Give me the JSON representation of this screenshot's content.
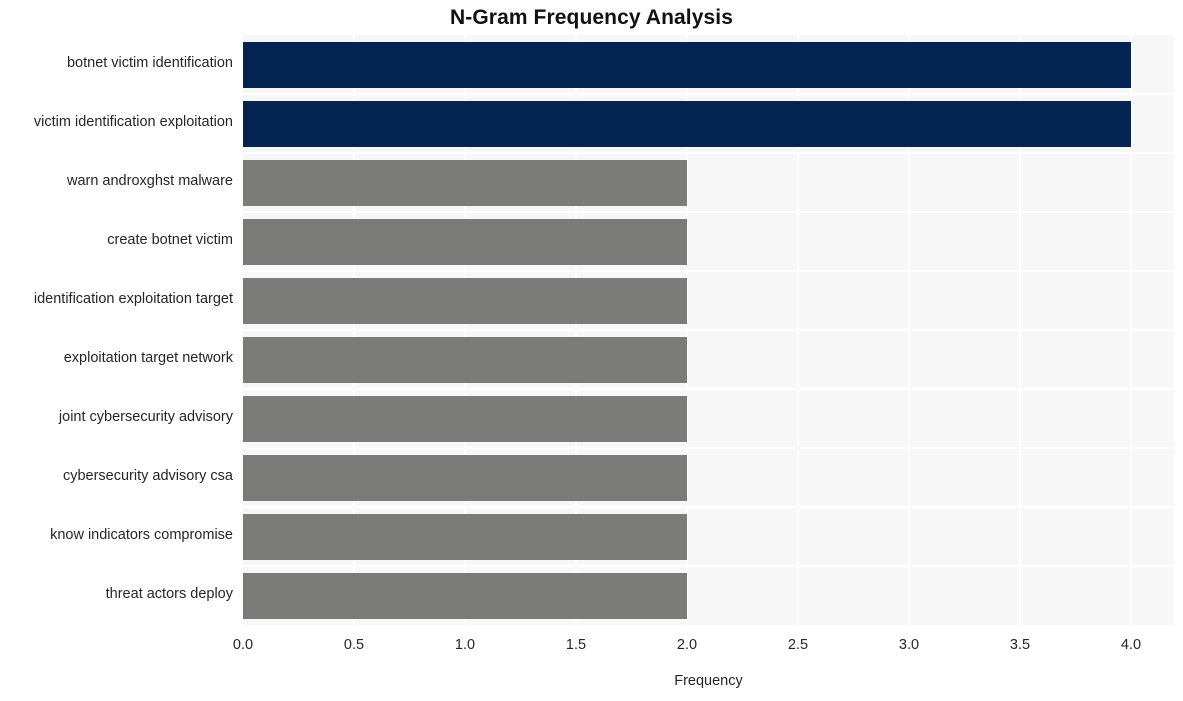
{
  "chart_data": {
    "type": "bar",
    "orientation": "horizontal",
    "title": "N-Gram Frequency Analysis",
    "xlabel": "Frequency",
    "ylabel": "",
    "xlim": [
      0.0,
      4.0
    ],
    "xticks": [
      "0.0",
      "0.5",
      "1.0",
      "1.5",
      "2.0",
      "2.5",
      "3.0",
      "3.5",
      "4.0"
    ],
    "xtick_values": [
      0.0,
      0.5,
      1.0,
      1.5,
      2.0,
      2.5,
      3.0,
      3.5,
      4.0
    ],
    "grid": true,
    "legend": null,
    "categories": [
      "botnet victim identification",
      "victim identification exploitation",
      "warn androxghst malware",
      "create botnet victim",
      "identification exploitation target",
      "exploitation target network",
      "joint cybersecurity advisory",
      "cybersecurity advisory csa",
      "know indicators compromise",
      "threat actors deploy"
    ],
    "values": [
      4,
      4,
      2,
      2,
      2,
      2,
      2,
      2,
      2,
      2
    ],
    "bar_colors": [
      "#042451",
      "#042451",
      "#7b7b79",
      "#7b7b79",
      "#7b7b79",
      "#7b7b79",
      "#7b7b79",
      "#7b7b79",
      "#7b7b79",
      "#7b7b79"
    ]
  },
  "style": {
    "plot_background": "#f7f7f7",
    "figure_background": "#ffffff",
    "gridline_color": "#ffffff",
    "text_color": "#262626",
    "title_color": "#111111",
    "accent_color": "#042451",
    "neutral_color": "#7b7b79"
  }
}
